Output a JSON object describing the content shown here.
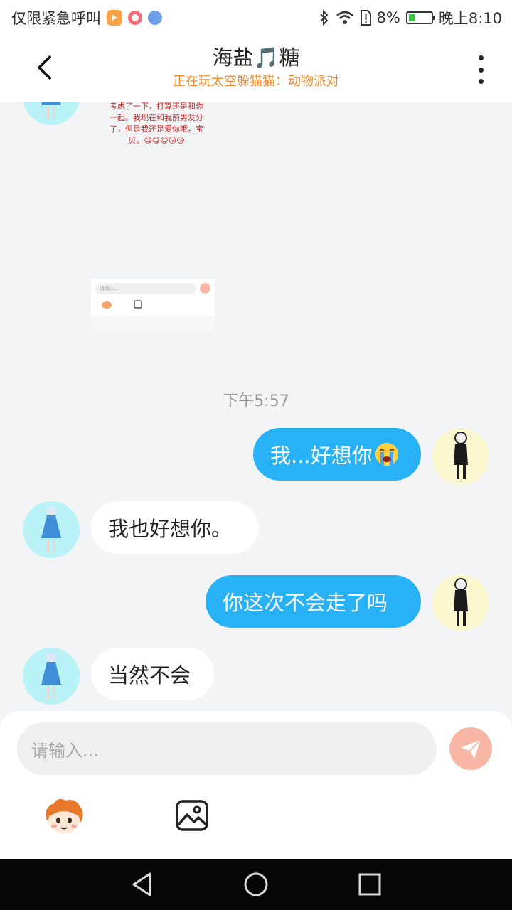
{
  "status_bar": {
    "carrier_text": "仅限紧急呼叫",
    "battery_percent": "8%",
    "time": "晚上8:10",
    "icons": [
      "video-app-icon",
      "record-app-icon",
      "browser-app-icon",
      "bluetooth-icon",
      "wifi-icon",
      "sim-alert-icon",
      "battery-charging-icon"
    ],
    "battery_level": 0.08
  },
  "header": {
    "title": "海盐🎵糖",
    "subtitle": "正在玩太空躲猫猫：动物派对"
  },
  "screenshot_message": {
    "text": "考虑了一下，打算还是和你一起。我现在和我前男友分了，但是我还是爱你哦，宝贝。😋😋😋😘😘",
    "mini_input_placeholder": "请输入..."
  },
  "timestamp": "下午5:57",
  "messages": [
    {
      "side": "out",
      "text": "我...好想你",
      "emoji": "😭"
    },
    {
      "side": "in",
      "text": "我也好想你。"
    },
    {
      "side": "out",
      "text": "你这次不会走了吗"
    },
    {
      "side": "in",
      "text": "当然不会"
    }
  ],
  "composer": {
    "placeholder": "请输入..."
  },
  "colors": {
    "outgoing_bubble": "#28b2f5",
    "incoming_bubble": "#ffffff",
    "subtitle": "#f28a2a",
    "send_button": "#f8b7a6",
    "her_avatar_bg": "#b9f2f7",
    "my_avatar_bg": "#fbf8cf"
  }
}
